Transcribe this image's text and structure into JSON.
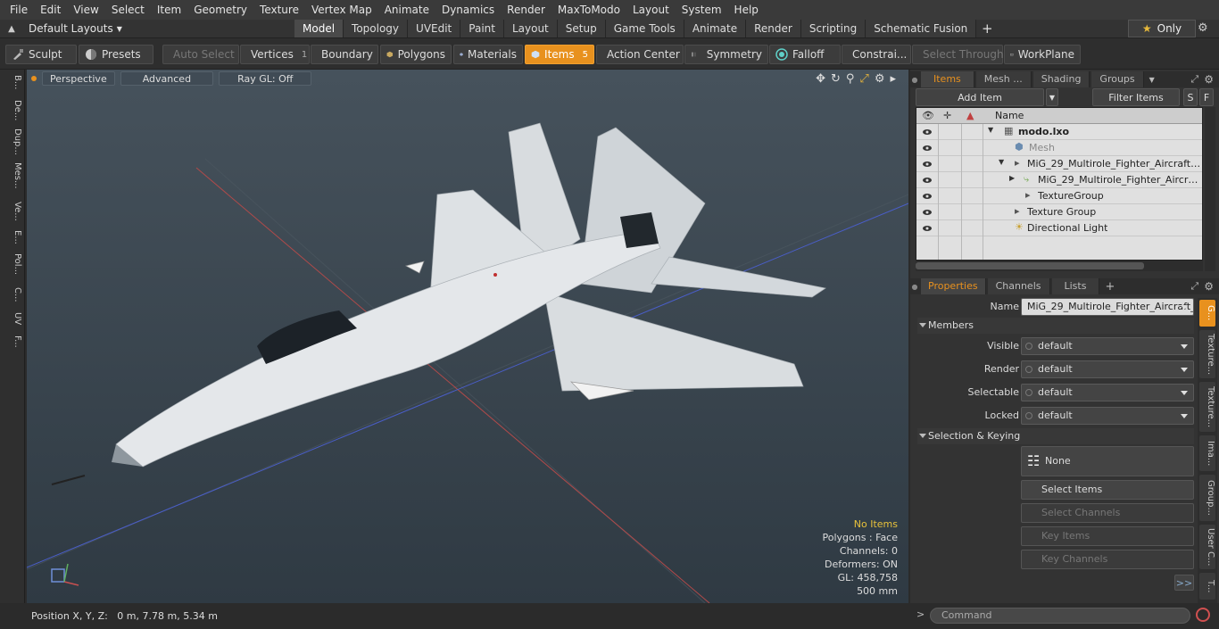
{
  "menu": [
    "File",
    "Edit",
    "View",
    "Select",
    "Item",
    "Geometry",
    "Texture",
    "Vertex Map",
    "Animate",
    "Dynamics",
    "Render",
    "MaxToModo",
    "Layout",
    "System",
    "Help"
  ],
  "layout": {
    "selector": "Default Layouts"
  },
  "layout_tabs": [
    "Model",
    "Topology",
    "UVEdit",
    "Paint",
    "Layout",
    "Setup",
    "Game Tools",
    "Animate",
    "Render",
    "Scripting",
    "Schematic Fusion"
  ],
  "only_label": "Only",
  "toolbar": {
    "sculpt": "Sculpt",
    "presets": "Presets",
    "auto_select": "Auto Select",
    "vertices": "Vertices",
    "vertices_count": "1",
    "boundary": "Boundary",
    "polygons": "Polygons",
    "materials": "Materials",
    "items": "Items",
    "items_count": "5",
    "action_center": "Action Center",
    "symmetry": "Symmetry",
    "falloff": "Falloff",
    "constraints": "Constrai...",
    "select_through": "Select Through",
    "workplane": "WorkPlane"
  },
  "left_tabs": [
    "B...",
    "De...",
    "Dup...",
    "Mes...",
    "Ve...",
    "E...",
    "Pol...",
    "C...",
    "UV",
    "F..."
  ],
  "viewport": {
    "perspective": "Perspective",
    "advanced": "Advanced",
    "raygl": "Ray GL: Off",
    "info": {
      "no_items": "No Items",
      "polygons": "Polygons : Face",
      "channels": "Channels: 0",
      "deformers": "Deformers: ON",
      "gl": "GL: 458,758",
      "scale": "500 mm"
    }
  },
  "status": {
    "position": "Position X, Y, Z:   0 m, 7.78 m, 5.34 m"
  },
  "items_panel": {
    "tabs": [
      "Items",
      "Mesh ...",
      "Shading",
      "Groups"
    ],
    "add_item": "Add Item",
    "filter": "Filter Items",
    "s_btn": "S",
    "f_btn": "F",
    "col_name": "Name",
    "rows": [
      {
        "name": "modo.lxo",
        "indent": 0
      },
      {
        "name": "Mesh",
        "indent": 1
      },
      {
        "name": "MiG_29_Multirole_Fighter_Aircraft_Fli...",
        "indent": 1
      },
      {
        "name": "MiG_29_Multirole_Fighter_Aircraft_...",
        "indent": 2
      },
      {
        "name": "TextureGroup",
        "indent": 2
      },
      {
        "name": "Texture Group",
        "indent": 1
      },
      {
        "name": "Directional Light",
        "indent": 1
      }
    ]
  },
  "properties": {
    "tabs": [
      "Properties",
      "Channels",
      "Lists"
    ],
    "name_label": "Name",
    "name_value": "MiG_29_Multirole_Fighter_Aircraft_Flig",
    "members": "Members",
    "visible_label": "Visible",
    "render_label": "Render",
    "selectable_label": "Selectable",
    "locked_label": "Locked",
    "default": "default",
    "sel_keying": "Selection & Keying",
    "none": "None",
    "select_items": "Select Items",
    "select_channels": "Select Channels",
    "key_items": "Key Items",
    "key_channels": "Key Channels",
    "more": ">>",
    "side_tabs": [
      "G...",
      "Texture...",
      "Texture...",
      "Ima...",
      "Group...",
      "User C...",
      "T..."
    ]
  },
  "command": {
    "placeholder": "Command"
  },
  "colors": {
    "accent": "#e8911e",
    "viewport": "#3d4a54"
  }
}
